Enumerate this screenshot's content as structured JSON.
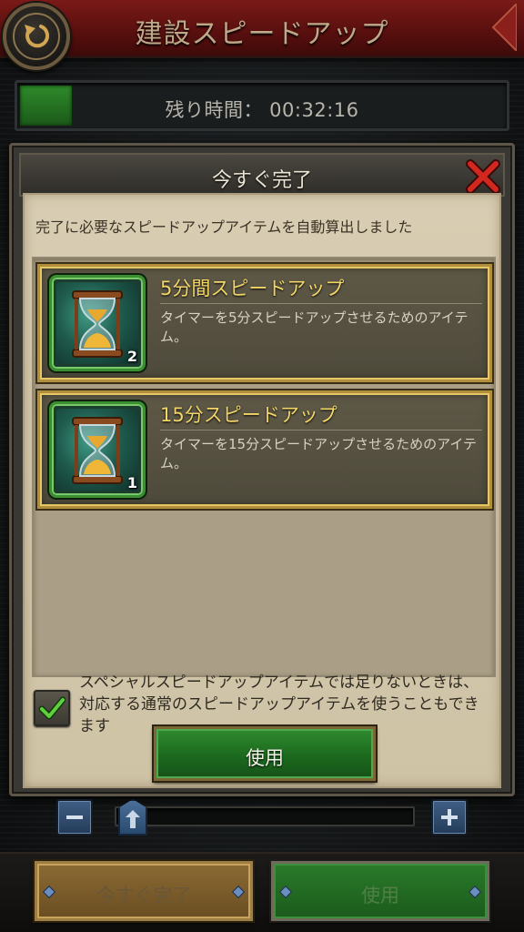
{
  "header": {
    "title": "建設スピードアップ",
    "back_icon": "back-arrow-icon",
    "color": "#6a1413"
  },
  "timer": {
    "label": "残り時間：",
    "value": "00:32:16",
    "progress_fraction": 0.1,
    "fill_color": "#2e8a2a"
  },
  "dialog": {
    "title": "今すぐ完了",
    "close_icon": "close-x-icon",
    "description": "完了に必要なスピードアップアイテムを自動算出しました",
    "items": [
      {
        "title": "5分間スピードアップ",
        "description": "タイマーを5分スピードアップさせるためのアイテム。",
        "count": "2",
        "icon": "hourglass-icon"
      },
      {
        "title": "15分スピードアップ",
        "description": "タイマーを15分スピードアップさせるためのアイテム。",
        "count": "1",
        "icon": "hourglass-icon"
      }
    ],
    "checkbox": {
      "checked": true,
      "label": "スペシャルスピードアップアイテムでは足りないときは、対応する通常のスピードアップアイテムを使うこともできます"
    },
    "use_button_label": "使用"
  },
  "slider": {
    "minus_icon": "minus-icon",
    "plus_icon": "plus-icon",
    "handle_icon": "slider-handle-icon",
    "value_fraction": 0.0
  },
  "bottom": {
    "complete_now_label": "今すぐ完了",
    "use_label": "使用"
  },
  "colors": {
    "accent_gold": "#f3d668",
    "green_button": "#1c6a1e",
    "parchment": "#d8cdb2"
  }
}
